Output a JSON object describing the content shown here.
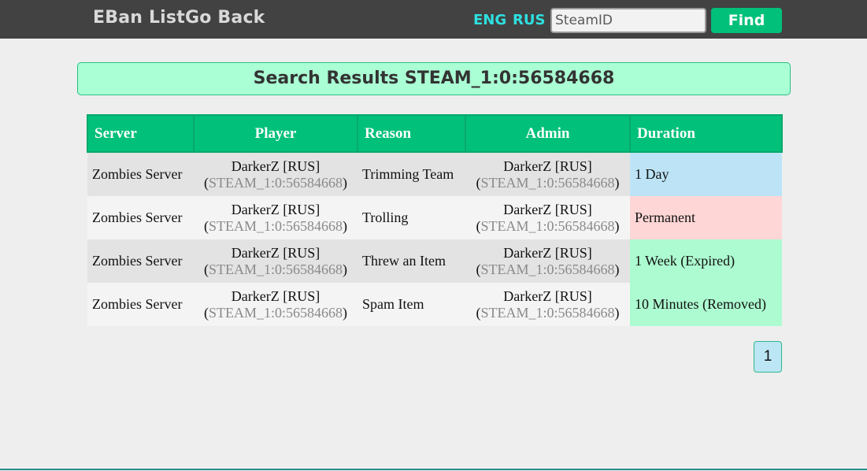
{
  "nav": {
    "eban_list": "EBan List",
    "go_back": "Go Back",
    "lang_eng": "ENG",
    "lang_rus": "RUS",
    "search_placeholder": "SteamID",
    "find": "Find"
  },
  "results_title": "Search Results STEAM_1:0:56584668",
  "table": {
    "headers": [
      "Server",
      "Player",
      "Reason",
      "Admin",
      "Duration"
    ],
    "rows": [
      {
        "server": "Zombies Server",
        "player_name": "DarkerZ [RUS]",
        "player_steam": "STEAM_1:0:56584668",
        "reason": "Trimming Team",
        "admin_name": "DarkerZ [RUS]",
        "admin_steam": "STEAM_1:0:56584668",
        "duration": "1 Day",
        "duration_status": "active"
      },
      {
        "server": "Zombies Server",
        "player_name": "DarkerZ [RUS]",
        "player_steam": "STEAM_1:0:56584668",
        "reason": "Trolling",
        "admin_name": "DarkerZ [RUS]",
        "admin_steam": "STEAM_1:0:56584668",
        "duration": "Permanent",
        "duration_status": "permanent"
      },
      {
        "server": "Zombies Server",
        "player_name": "DarkerZ [RUS]",
        "player_steam": "STEAM_1:0:56584668",
        "reason": "Threw an Item",
        "admin_name": "DarkerZ [RUS]",
        "admin_steam": "STEAM_1:0:56584668",
        "duration": "1 Week (Expired)",
        "duration_status": "expired"
      },
      {
        "server": "Zombies Server",
        "player_name": "DarkerZ [RUS]",
        "player_steam": "STEAM_1:0:56584668",
        "reason": "Spam Item",
        "admin_name": "DarkerZ [RUS]",
        "admin_steam": "STEAM_1:0:56584668",
        "duration": "10 Minutes (Removed)",
        "duration_status": "removed"
      }
    ]
  },
  "pagination": {
    "current_page": "1"
  },
  "colors": {
    "header_bar": "#424242",
    "accent_green": "#00c07a",
    "banner_bg": "#aaffd4",
    "duration_active": "#bde4f6",
    "duration_permanent": "#ffd6d6",
    "duration_expired": "#adfbd0"
  }
}
